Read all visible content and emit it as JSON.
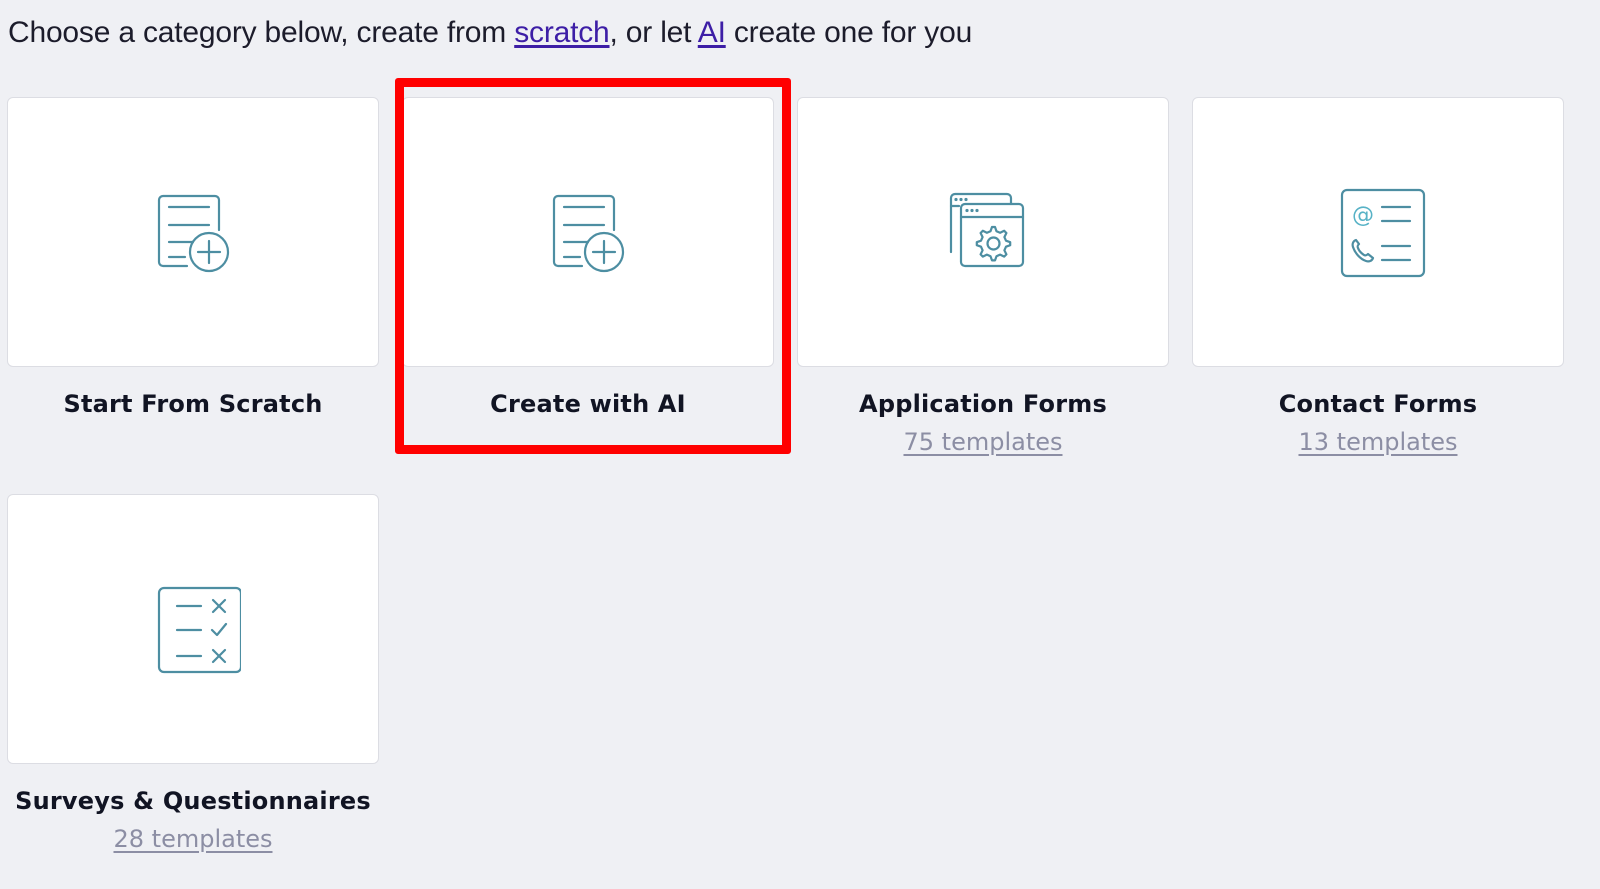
{
  "intro": {
    "prefix": "Choose a category below, create from ",
    "scratch_link": "scratch",
    "middle": ", or let ",
    "ai_link": "AI",
    "suffix": " create one for you"
  },
  "cards": [
    {
      "title": "Start From Scratch",
      "icon": "form-add-icon"
    },
    {
      "title": "Create with AI",
      "icon": "form-add-icon"
    },
    {
      "title": "Application Forms",
      "subtitle": "75 templates",
      "icon": "windows-gear-icon"
    },
    {
      "title": "Contact Forms",
      "subtitle": "13 templates",
      "icon": "contact-card-icon"
    },
    {
      "title": "Surveys & Questionnaires",
      "subtitle": "28 templates",
      "icon": "checklist-icon"
    }
  ],
  "colors": {
    "background": "#eff0f4",
    "icon": "#4d8ea2",
    "highlight": "#ff0000",
    "link": "#3d1ea6"
  }
}
